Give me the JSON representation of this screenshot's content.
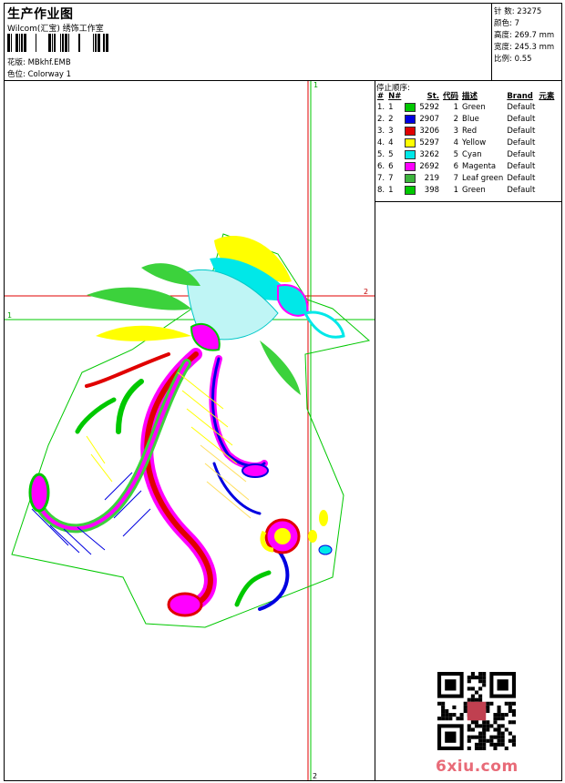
{
  "header": {
    "title": "生产作业图",
    "subtitle": "Wilcom(汇宝) 绣饰工作室",
    "design_label": "花版:",
    "design_value": "MBkhf.EMB",
    "colorway_label": "色位:",
    "colorway_value": "Colorway 1"
  },
  "stats": [
    {
      "label": "针 数:",
      "value": "23275"
    },
    {
      "label": "颜色:",
      "value": "7"
    },
    {
      "label": "高度:",
      "value": "269.7 mm"
    },
    {
      "label": "宽度:",
      "value": "245.3 mm"
    },
    {
      "label": "比例:",
      "value": "0.55"
    }
  ],
  "stop_sequence": {
    "title": "停止顺序:",
    "columns": [
      "#",
      "N#",
      "St.",
      "代码",
      "描述",
      "Brand",
      "元素"
    ],
    "rows": [
      {
        "index": "1.",
        "n": "1",
        "color": "#00c800",
        "stitches": "5292",
        "code": "1",
        "desc": "Green",
        "brand": "Default"
      },
      {
        "index": "2.",
        "n": "2",
        "color": "#0000e0",
        "stitches": "2907",
        "code": "2",
        "desc": "Blue",
        "brand": "Default"
      },
      {
        "index": "3.",
        "n": "3",
        "color": "#e00000",
        "stitches": "3206",
        "code": "3",
        "desc": "Red",
        "brand": "Default"
      },
      {
        "index": "4.",
        "n": "4",
        "color": "#ffff00",
        "stitches": "5297",
        "code": "4",
        "desc": "Yellow",
        "brand": "Default"
      },
      {
        "index": "5.",
        "n": "5",
        "color": "#00e8e8",
        "stitches": "3262",
        "code": "5",
        "desc": "Cyan",
        "brand": "Default"
      },
      {
        "index": "6.",
        "n": "6",
        "color": "#ff00ff",
        "stitches": "2692",
        "code": "6",
        "desc": "Magenta",
        "brand": "Default"
      },
      {
        "index": "7.",
        "n": "7",
        "color": "#3cb43c",
        "stitches": "219",
        "code": "7",
        "desc": "Leaf green",
        "brand": "Default"
      },
      {
        "index": "8.",
        "n": "1",
        "color": "#00c800",
        "stitches": "398",
        "code": "1",
        "desc": "Green",
        "brand": "Default"
      }
    ]
  },
  "guides": {
    "vertical_1_label": "1",
    "vertical_2_label": "2",
    "horizontal_1_label": "1",
    "horizontal_2_label": "2"
  },
  "watermark": "6xiu.com",
  "colors": {
    "guide_red": "#e00000",
    "guide_green": "#00c800",
    "outline": "#00c800"
  }
}
